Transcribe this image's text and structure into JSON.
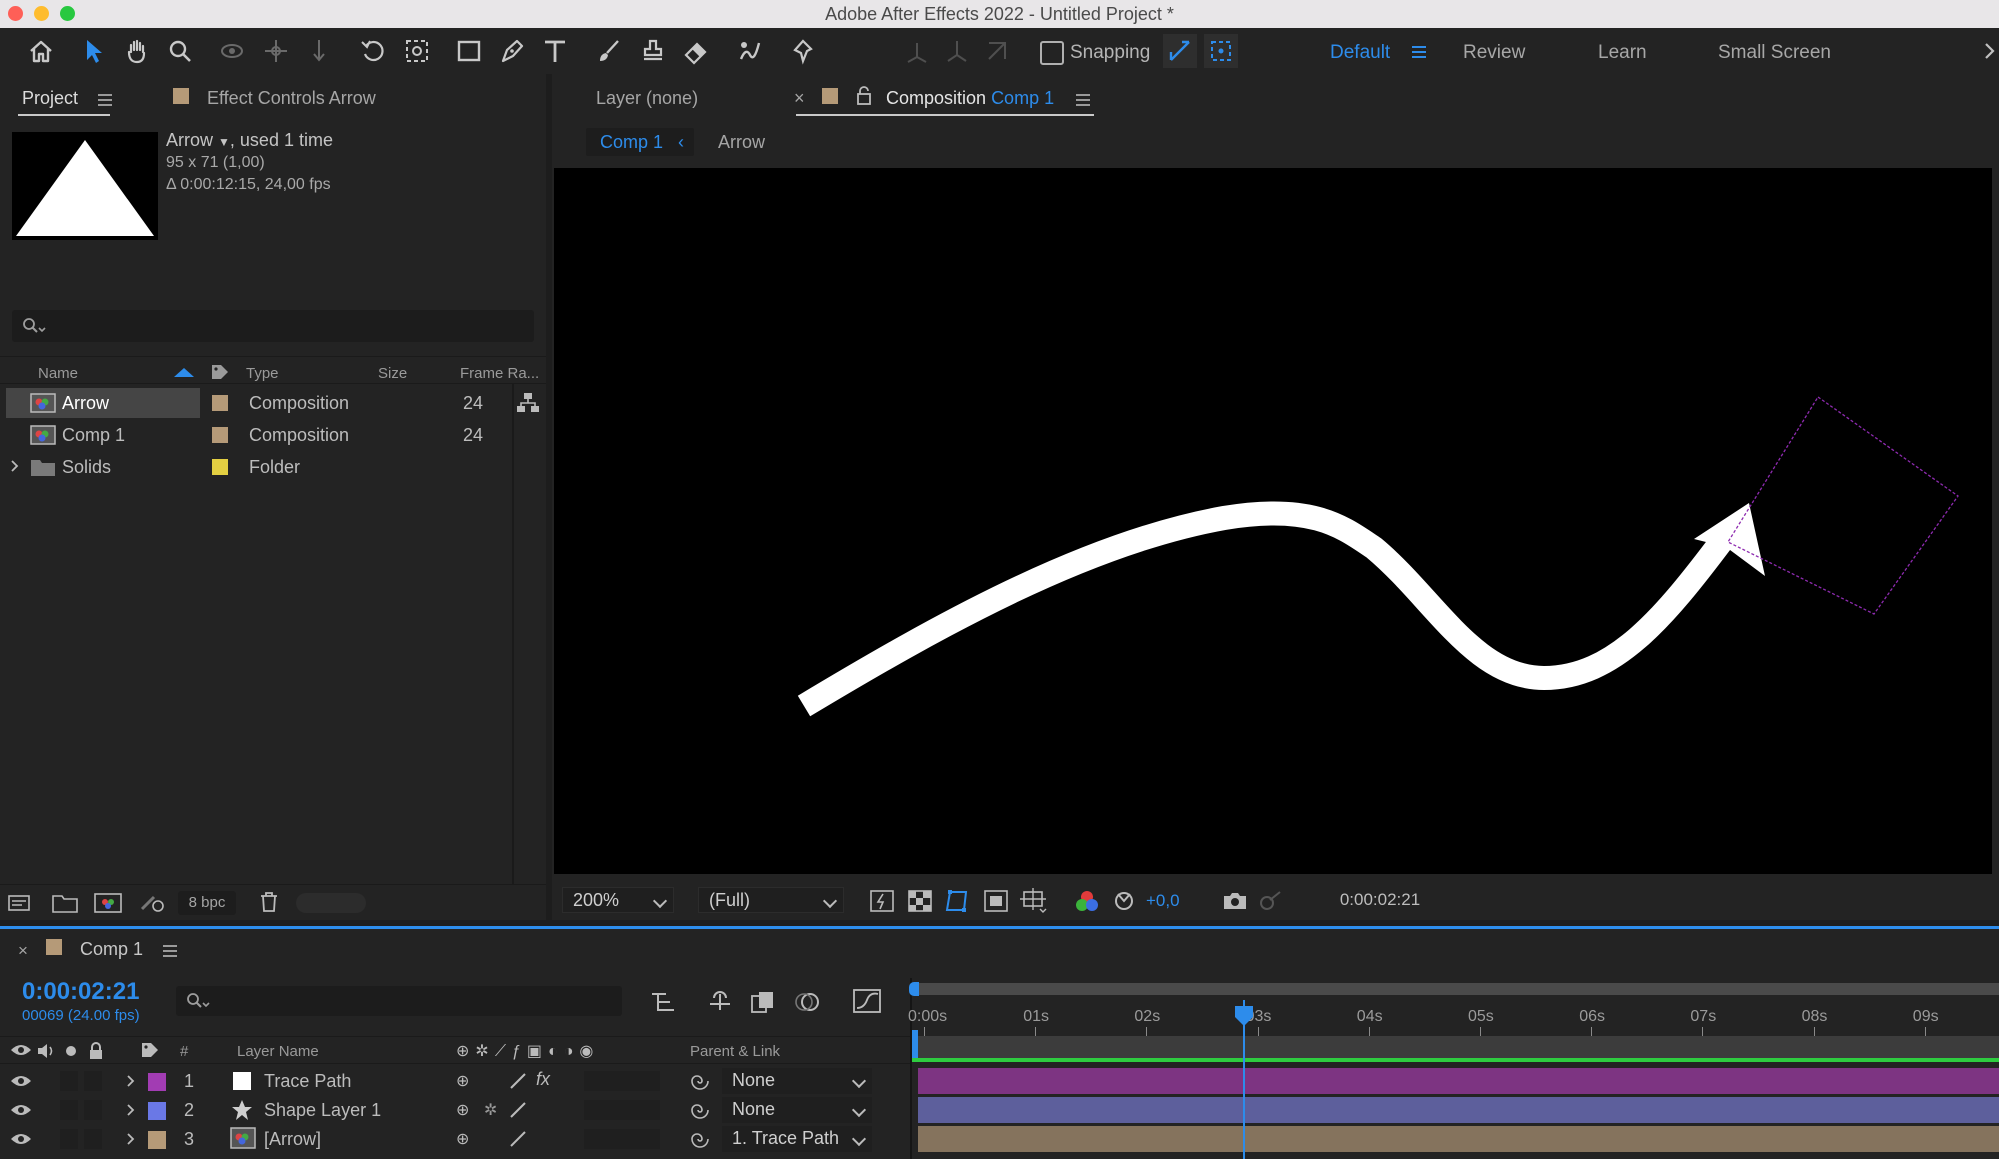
{
  "window": {
    "title": "Adobe After Effects 2022 - Untitled Project *"
  },
  "toolbar": {
    "snapping_label": "Snapping",
    "workspaces": [
      "Default",
      "Review",
      "Learn",
      "Small Screen"
    ],
    "tools": [
      "home-icon",
      "selection-tool-icon",
      "hand-tool-icon",
      "zoom-tool-icon",
      "orbit-camera-icon",
      "pan-camera-icon",
      "dolly-camera-icon",
      "rotation-tool-icon",
      "anchor-point-tool-icon",
      "rectangle-tool-icon",
      "pen-tool-icon",
      "type-tool-icon",
      "brush-tool-icon",
      "clone-stamp-icon",
      "eraser-tool-icon",
      "roto-brush-icon",
      "puppet-pin-icon"
    ]
  },
  "project": {
    "tab_label": "Project",
    "effect_controls_label": "Effect Controls Arrow",
    "preview": {
      "name": "Arrow",
      "used": ", used 1 time",
      "dims": "95 x 71 (1,00)",
      "duration": "Δ 0:00:12:15, 24,00 fps"
    },
    "columns": {
      "name": "Name",
      "type": "Type",
      "size": "Size",
      "frame_rate": "Frame Ra..."
    },
    "items": [
      {
        "name": "Arrow",
        "type": "Composition",
        "frame_rate": "24",
        "color": "#b59a78"
      },
      {
        "name": "Comp 1",
        "type": "Composition",
        "frame_rate": "24",
        "color": "#b59a78"
      },
      {
        "name": "Solids",
        "type": "Folder",
        "frame_rate": "",
        "color": "#e3cf42"
      }
    ],
    "bpc": "8 bpc"
  },
  "viewer": {
    "layer_tab": "Layer (none)",
    "comp_tab_prefix": "Composition",
    "comp_tab_name": "Comp 1",
    "breadcrumb_comp": "Comp 1",
    "breadcrumb_layer": "Arrow",
    "zoom": "200%",
    "resolution": "(Full)",
    "exposure": "+0,0",
    "timecode": "0:00:02:21"
  },
  "timeline": {
    "comp_name": "Comp 1",
    "current_time": "0:00:02:21",
    "frame_info": "00069 (24.00 fps)",
    "columns": {
      "number": "#",
      "layer_name": "Layer Name",
      "parent": "Parent & Link"
    },
    "layers": [
      {
        "num": "1",
        "name": "Trace Path",
        "label_color": "#a23cb3",
        "parent": "None",
        "bar_color": "#7d3482"
      },
      {
        "num": "2",
        "name": "Shape Layer 1",
        "label_color": "#6a78e6",
        "parent": "None",
        "bar_color": "#5d5f9c"
      },
      {
        "num": "3",
        "name": "[Arrow]",
        "label_color": "#b59a78",
        "parent": "1. Trace Path",
        "bar_color": "#85735d"
      }
    ],
    "ruler": [
      "0:00s",
      "01s",
      "02s",
      "03s",
      "04s",
      "05s",
      "06s",
      "07s",
      "08s",
      "09s"
    ],
    "playhead_seconds": 2.875
  },
  "colors": {
    "accent": "#2d8ceb",
    "panel": "#232323",
    "panel_dark": "#1d1d1d"
  }
}
